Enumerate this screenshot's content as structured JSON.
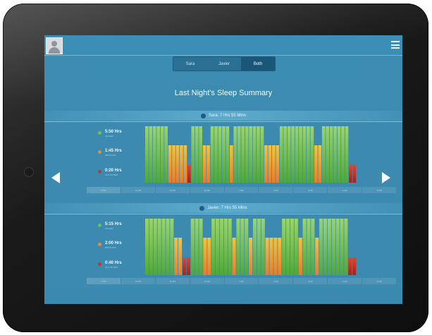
{
  "tabs": [
    {
      "label": "Sara",
      "active": false
    },
    {
      "label": "Javier",
      "active": false
    },
    {
      "label": "Both",
      "active": true
    }
  ],
  "title": "Last Night's Sleep Summary",
  "colors": {
    "asleep": "#5cb83c",
    "restless": "#f19a2c",
    "out_of_bed": "#c22626",
    "screen_bg": "#3a8bb1"
  },
  "sections": [
    {
      "person": "Sara: 7 Hrs 55 Mins",
      "legend": [
        {
          "value": "5:50 Hrs",
          "sublabel": "ASLEEP",
          "color": "#6cc24a"
        },
        {
          "value": "1:45 Hrs",
          "sublabel": "RESTLESS",
          "color": "#f08a2a"
        },
        {
          "value": "0:20 Hrs",
          "sublabel": "OUT OF BED",
          "color": "#c0392b"
        }
      ],
      "timeline": [
        {
          "state": "asleep",
          "bars": 6
        },
        {
          "state": "restless",
          "bars": 5
        },
        {
          "state": "out",
          "bars": 1
        },
        {
          "state": "asleep",
          "bars": 3
        },
        {
          "state": "restless",
          "bars": 2
        },
        {
          "state": "asleep",
          "bars": 5
        },
        {
          "state": "restless",
          "bars": 1
        },
        {
          "state": "asleep",
          "bars": 8
        },
        {
          "state": "restless",
          "bars": 4
        },
        {
          "state": "asleep",
          "bars": 9
        },
        {
          "state": "restless",
          "bars": 2
        },
        {
          "state": "asleep",
          "bars": 7
        },
        {
          "state": "out",
          "bars": 2
        }
      ],
      "axis": [
        "9 PM",
        "10 PM",
        "11 PM",
        "12 AM",
        "1 AM",
        "2 AM",
        "3 AM",
        "4 AM",
        "5 AM"
      ]
    },
    {
      "person": "Javier: 7 Hrs 55 Mins",
      "legend": [
        {
          "value": "5:15 Hrs",
          "sublabel": "ASLEEP",
          "color": "#6cc24a"
        },
        {
          "value": "2:00 Hrs",
          "sublabel": "RESTLESS",
          "color": "#f08a2a"
        },
        {
          "value": "0:40 Hrs",
          "sublabel": "OUT OF BED",
          "color": "#c0392b"
        }
      ],
      "timeline": [
        {
          "state": "asleep",
          "bars": 7
        },
        {
          "state": "restless",
          "bars": 2
        },
        {
          "state": "out",
          "bars": 2
        },
        {
          "state": "asleep",
          "bars": 3
        },
        {
          "state": "restless",
          "bars": 2
        },
        {
          "state": "asleep",
          "bars": 5
        },
        {
          "state": "restless",
          "bars": 1
        },
        {
          "state": "asleep",
          "bars": 3
        },
        {
          "state": "restless",
          "bars": 1
        },
        {
          "state": "asleep",
          "bars": 3
        },
        {
          "state": "restless",
          "bars": 4
        },
        {
          "state": "asleep",
          "bars": 4
        },
        {
          "state": "restless",
          "bars": 1
        },
        {
          "state": "asleep",
          "bars": 3
        },
        {
          "state": "restless",
          "bars": 1
        },
        {
          "state": "asleep",
          "bars": 7
        },
        {
          "state": "out",
          "bars": 2
        }
      ],
      "axis": [
        "9 PM",
        "10 PM",
        "11 PM",
        "12 AM",
        "1 AM",
        "2 AM",
        "3 AM",
        "4 AM",
        "5 AM"
      ]
    }
  ]
}
